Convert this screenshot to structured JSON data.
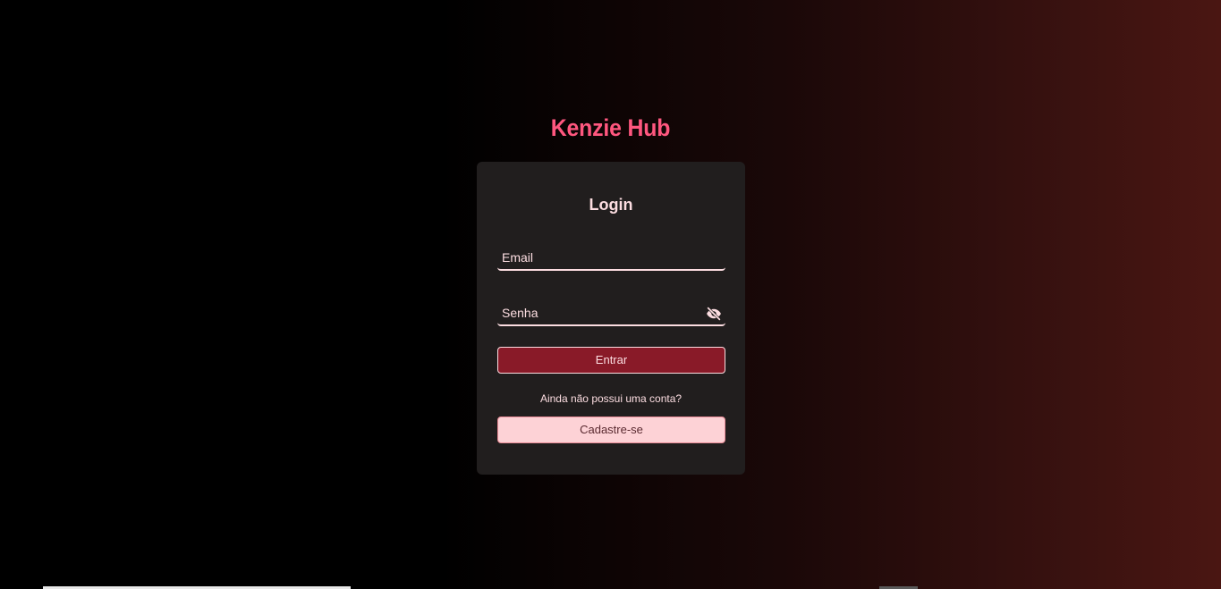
{
  "app": {
    "brand": "Kenzie Hub"
  },
  "login": {
    "title": "Login",
    "email_placeholder": "Email",
    "password_placeholder": "Senha",
    "password_toggle_icon": "eye-off-icon",
    "submit_label": "Entrar",
    "signup_prompt": "Ainda não possui uma conta?",
    "signup_label": "Cadastre-se"
  },
  "colors": {
    "brand": "#ff577f",
    "card_background": "#211e1e",
    "primary_button": "#891a28",
    "secondary_button": "#fdd2d6",
    "text": "#fcdde1"
  }
}
